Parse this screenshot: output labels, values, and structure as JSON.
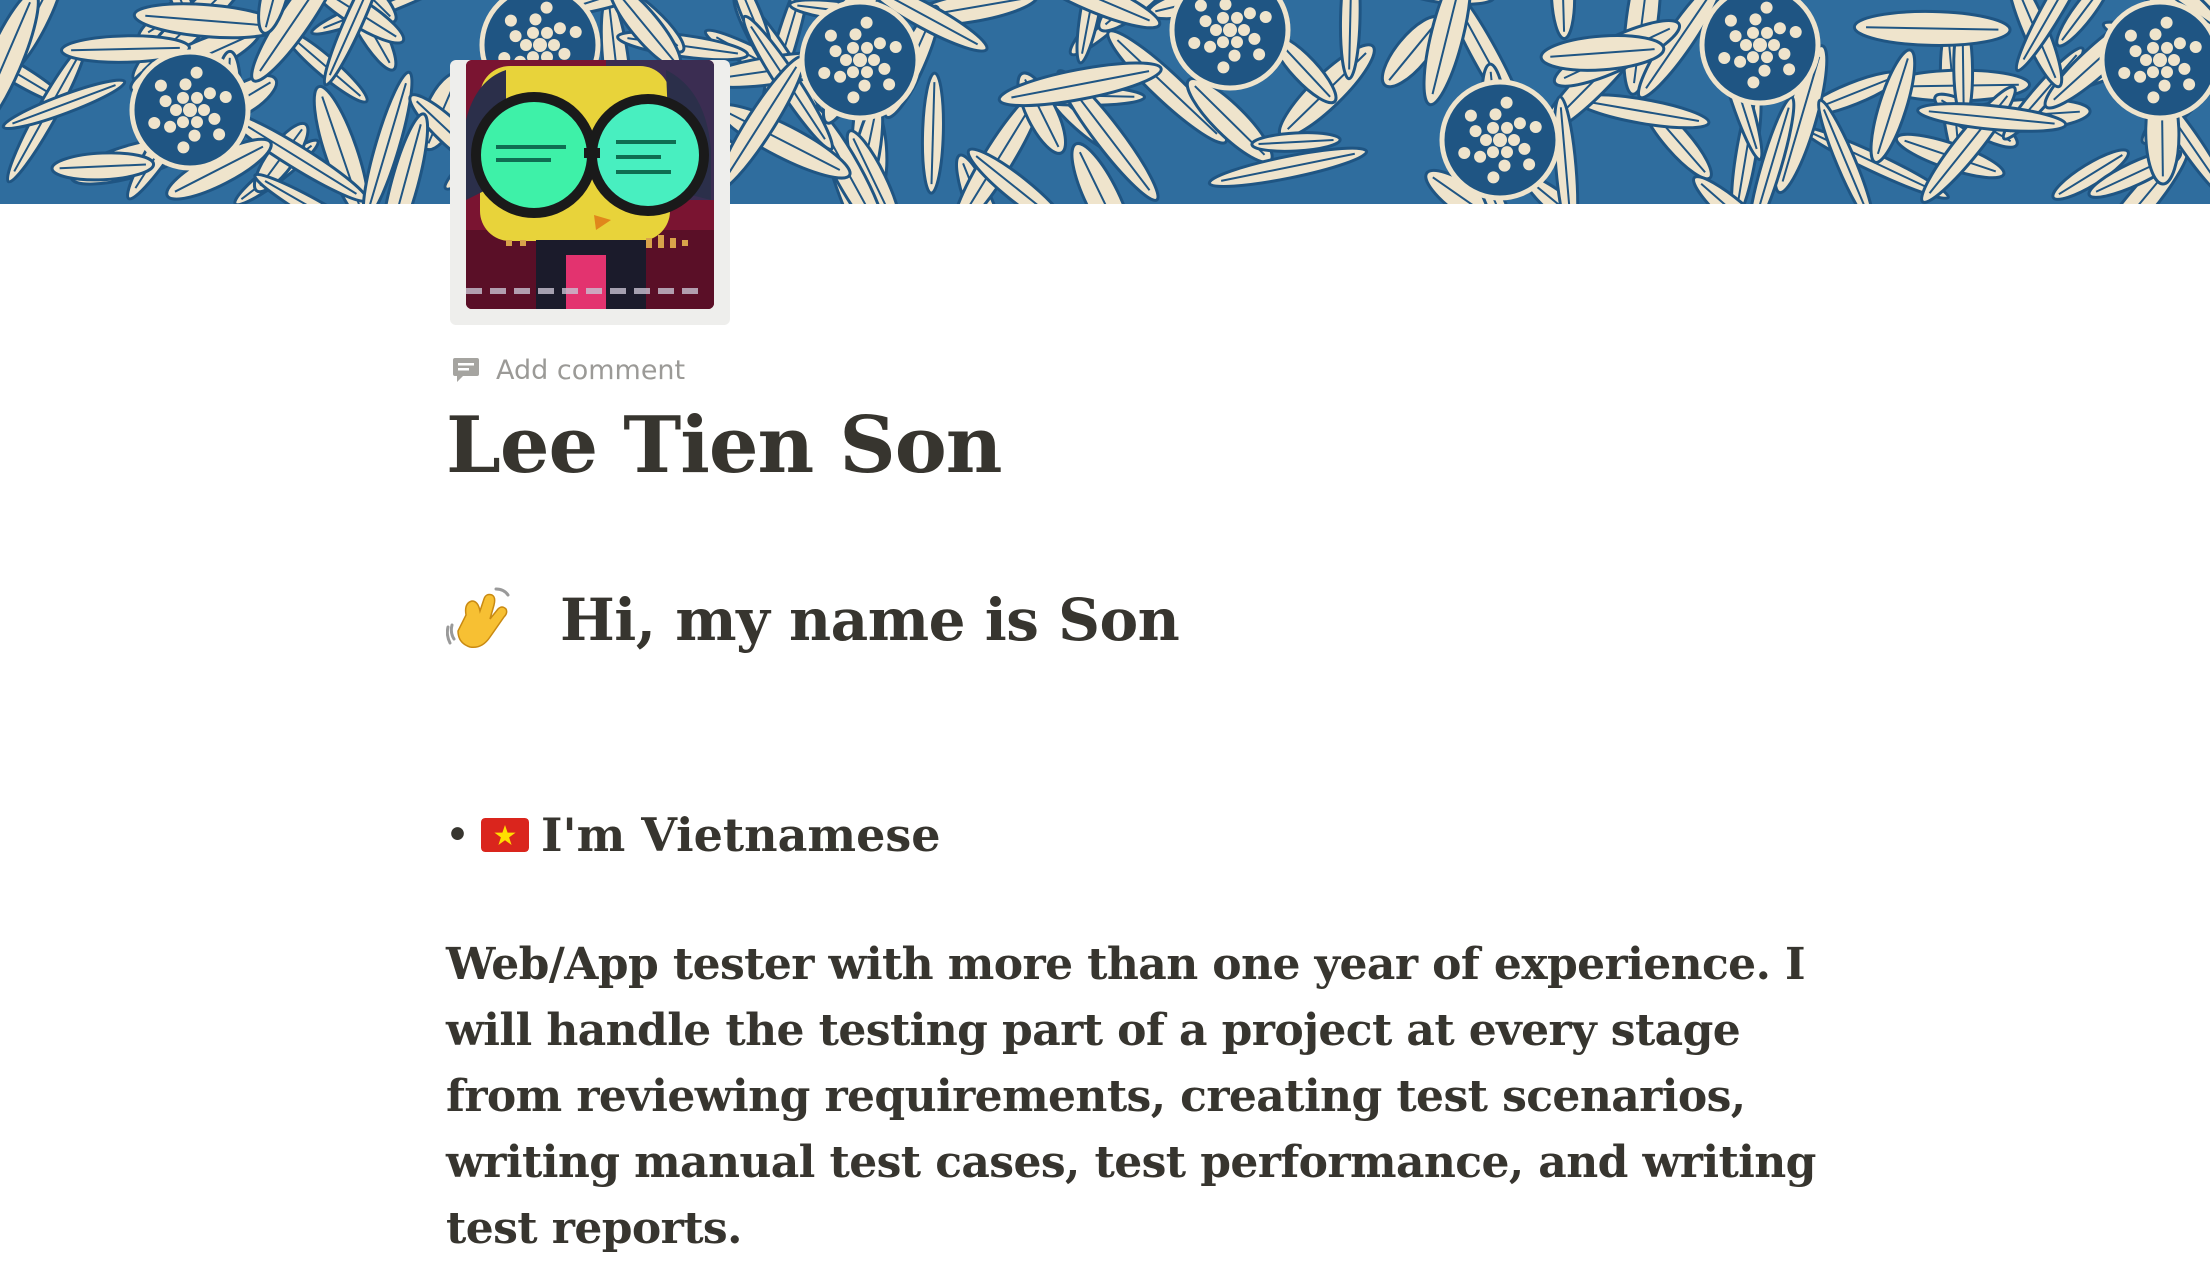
{
  "cover": {
    "pattern": "blue-floral-leaves",
    "colors": {
      "base": "#2f6d9e",
      "leaf": "#efe4cc",
      "accent": "#1f5583"
    }
  },
  "page_icon": {
    "description_icon": "robot-avatar-icon",
    "colors": {
      "background": "#7a1431",
      "face": "#e8d33a",
      "lens": "#3ef1a8"
    }
  },
  "comment": {
    "label": "Add comment",
    "icon": "comment-icon"
  },
  "page": {
    "title": "Lee Tien Son"
  },
  "greeting": {
    "emoji_icon": "waving-hand-icon",
    "text": "Hi, my name is Son"
  },
  "nationality": {
    "bullet": "•",
    "flag_icon": "vietnam-flag-icon",
    "text": "I'm Vietnamese"
  },
  "bio": {
    "text": "Web/App tester with more than one year of experience. I will handle the testing part of a project at every stage from reviewing requirements, creating test scenarios, writing manual test cases, test performance, and writing test reports."
  }
}
